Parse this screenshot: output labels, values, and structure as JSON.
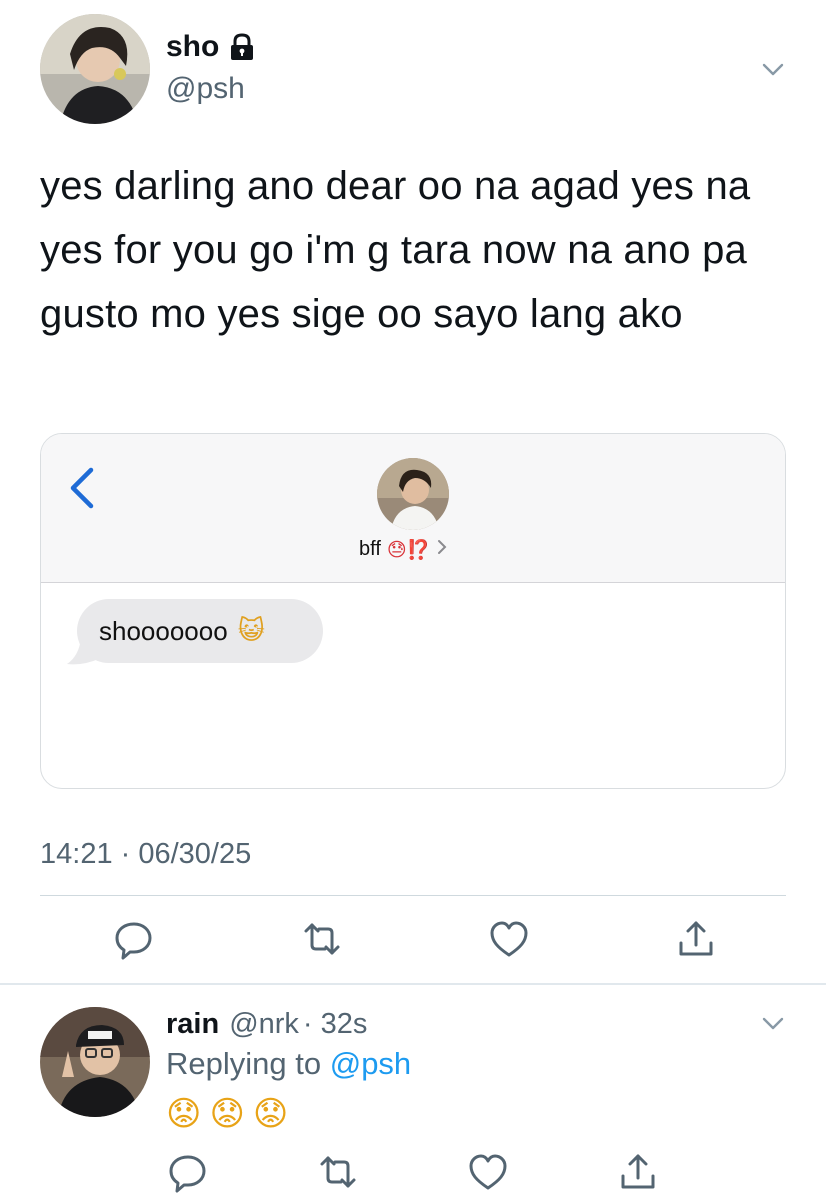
{
  "tweet": {
    "author": {
      "name": "sho",
      "handle": "@psh",
      "locked": true
    },
    "text": "yes darling ano dear oo na agad yes na yes for you go i'm g tara now na ano pa gusto mo yes sige oo sayo lang ako",
    "timestamp": "14:21 · 06/30/25"
  },
  "embedded_chat": {
    "contact_name": "bff",
    "contact_emoji": "😓⁉️",
    "message": "shooooooo",
    "message_emoji": "😺"
  },
  "reply": {
    "author": {
      "name": "rain",
      "handle": "@nrk",
      "time": "· 32s"
    },
    "replying_prefix": "Replying to",
    "replying_to": "@psh",
    "emojis": [
      "😟",
      "😟",
      "😟"
    ]
  },
  "actions": [
    "reply-icon",
    "retweet-icon",
    "like-icon",
    "share-icon"
  ],
  "colors": {
    "link": "#1d9bf0",
    "secondary_text": "#536471",
    "back_chevron": "#1e6bd6"
  }
}
